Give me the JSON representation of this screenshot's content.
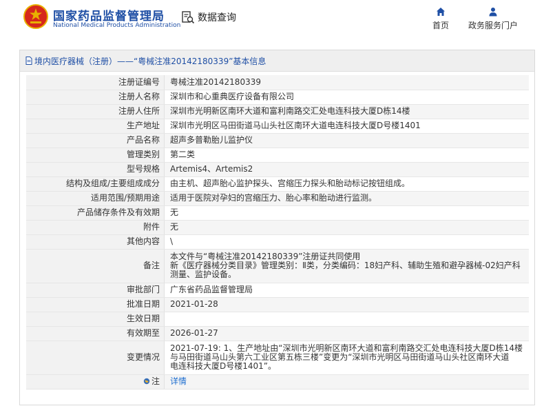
{
  "header": {
    "logo_cn": "国家药品监督管理局",
    "logo_en": "National Medical Products Administration",
    "query_label": "数据查询",
    "nav": {
      "home": "首页",
      "portal": "政务服务门户"
    }
  },
  "panel": {
    "title": "境内医疗器械（注册）——“粤械注准20142180339”基本信息"
  },
  "fields": {
    "reg_no": {
      "label": "注册证编号",
      "value": "粤械注准20142180339"
    },
    "registrant": {
      "label": "注册人名称",
      "value": "深圳市和心重典医疗设备有限公司"
    },
    "address": {
      "label": "注册人住所",
      "value": "深圳市光明新区南环大道和富利南路交汇处电连科技大厦D栋14楼"
    },
    "prod_addr": {
      "label": "生产地址",
      "value": "深圳市光明区马田街道马山头社区南环大道电连科技大厦D号楼1401"
    },
    "product": {
      "label": "产品名称",
      "value": "超声多普勒胎儿监护仪"
    },
    "category": {
      "label": "管理类别",
      "value": "第二类"
    },
    "model": {
      "label": "型号规格",
      "value": "Artemis4、Artemis2"
    },
    "structure": {
      "label": "结构及组成/主要组成成分",
      "value": "由主机、超声胎心监护探头、宫缩压力探头和胎动标记按钮组成。"
    },
    "scope": {
      "label": "适用范围/预期用途",
      "value": "适用于医院对孕妇的宫缩压力、胎心率和胎动进行监测。"
    },
    "storage": {
      "label": "产品储存条件及有效期",
      "value": "无"
    },
    "attachment": {
      "label": "附件",
      "value": "无"
    },
    "other": {
      "label": "其他内容",
      "value": "\\"
    },
    "note": {
      "label": "备注",
      "line1": "本文件与“粤械注准20142180339”注册证共同使用",
      "line2": "新《医疗器械分类目录》管理类别：Ⅱ类，分类编码：18妇产科、辅助生殖和避孕器械-02妇产科",
      "line3": "测量、监护设备。"
    },
    "dept": {
      "label": "审批部门",
      "value": "广东省药品监督管理局"
    },
    "approve_date": {
      "label": "批准日期",
      "value": "2021-01-28"
    },
    "effective_date": {
      "label": "生效日期",
      "value": ""
    },
    "valid_until": {
      "label": "有效期至",
      "value": "2026-01-27"
    },
    "change": {
      "label": "变更情况",
      "line1": "2021-07-19: 1、生产地址由“深圳市光明新区南环大道和富利南路交汇处电连科技大厦D栋14楼",
      "line2": "与马田街道马山头第六工业区第五栋三楼”变更为“深圳市光明区马田街道马山头社区南环大道",
      "line3": "电连科技大厦D号楼1401”。"
    },
    "remark": {
      "label": "注",
      "link": "详情"
    }
  },
  "icons": {
    "emblem": "national-emblem-icon",
    "query": "data-query-icon",
    "home": "home-icon",
    "portal": "user-icon",
    "doc": "document-icon",
    "remark": "globe-icon"
  },
  "colors": {
    "brand_blue": "#1f4fa5",
    "link_blue": "#1f6fd0",
    "emblem_red": "#d6281c",
    "emblem_gold": "#e8b100"
  }
}
